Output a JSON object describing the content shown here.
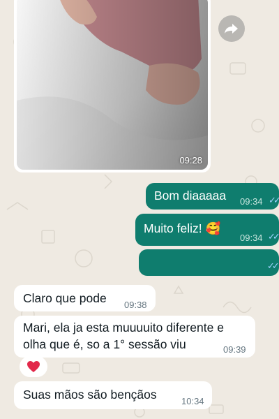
{
  "chat": {
    "image_message": {
      "time": "09:28"
    },
    "messages": [
      {
        "dir": "out",
        "text": "Bom diaaaaa",
        "time": "09:34",
        "status": "read"
      },
      {
        "dir": "out",
        "text": "Muito feliz! 🥰",
        "time": "09:34",
        "status": "read"
      },
      {
        "dir": "out",
        "text": "",
        "time": "",
        "status": "read"
      },
      {
        "dir": "in",
        "text": "Claro que pode",
        "time": "09:38"
      },
      {
        "dir": "in",
        "text_line1": "Mari, ela ja esta muuuuito diferente e",
        "text_line2": "olha que é, so a 1° sessão viu",
        "time": "09:39"
      },
      {
        "dir": "in",
        "reaction": "heart"
      },
      {
        "dir": "in",
        "text": "Suas mãos são bençãos",
        "time": "10:34"
      }
    ]
  },
  "icons": {
    "forward": "forward-icon",
    "read_ticks": "double-check-icon",
    "reaction": "heart-icon"
  },
  "colors": {
    "outgoing": "#0f7d6e",
    "incoming": "#ffffff",
    "background": "#efeae2",
    "ticks": "#9fd3ff"
  }
}
